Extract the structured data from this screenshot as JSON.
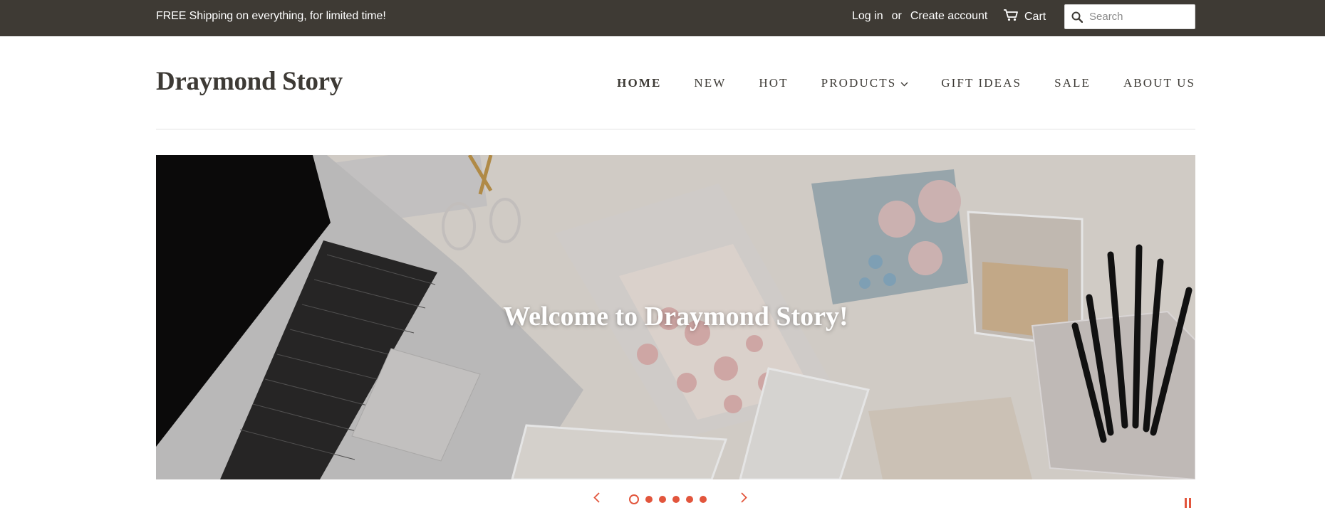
{
  "topbar": {
    "promo": "FREE Shipping on everything, for limited time!",
    "login_label": "Log in",
    "or_label": "or",
    "create_account_label": "Create account",
    "cart_label": "Cart",
    "cart_icon": "cart-icon",
    "search_icon": "search-icon",
    "search_placeholder": "Search"
  },
  "header": {
    "logo": "Draymond Story",
    "nav": [
      {
        "label": "HOME",
        "active": true
      },
      {
        "label": "NEW"
      },
      {
        "label": "HOT"
      },
      {
        "label": "PRODUCTS",
        "has_dropdown": true
      },
      {
        "label": "GIFT IDEAS"
      },
      {
        "label": "SALE"
      },
      {
        "label": "ABOUT US"
      }
    ]
  },
  "hero": {
    "caption": "Welcome to Draymond Story!",
    "slide_count": 6,
    "active_slide": 1
  },
  "colors": {
    "topbar_bg": "#3e3a34",
    "text": "#3d3a35",
    "accent": "#e2553c"
  }
}
